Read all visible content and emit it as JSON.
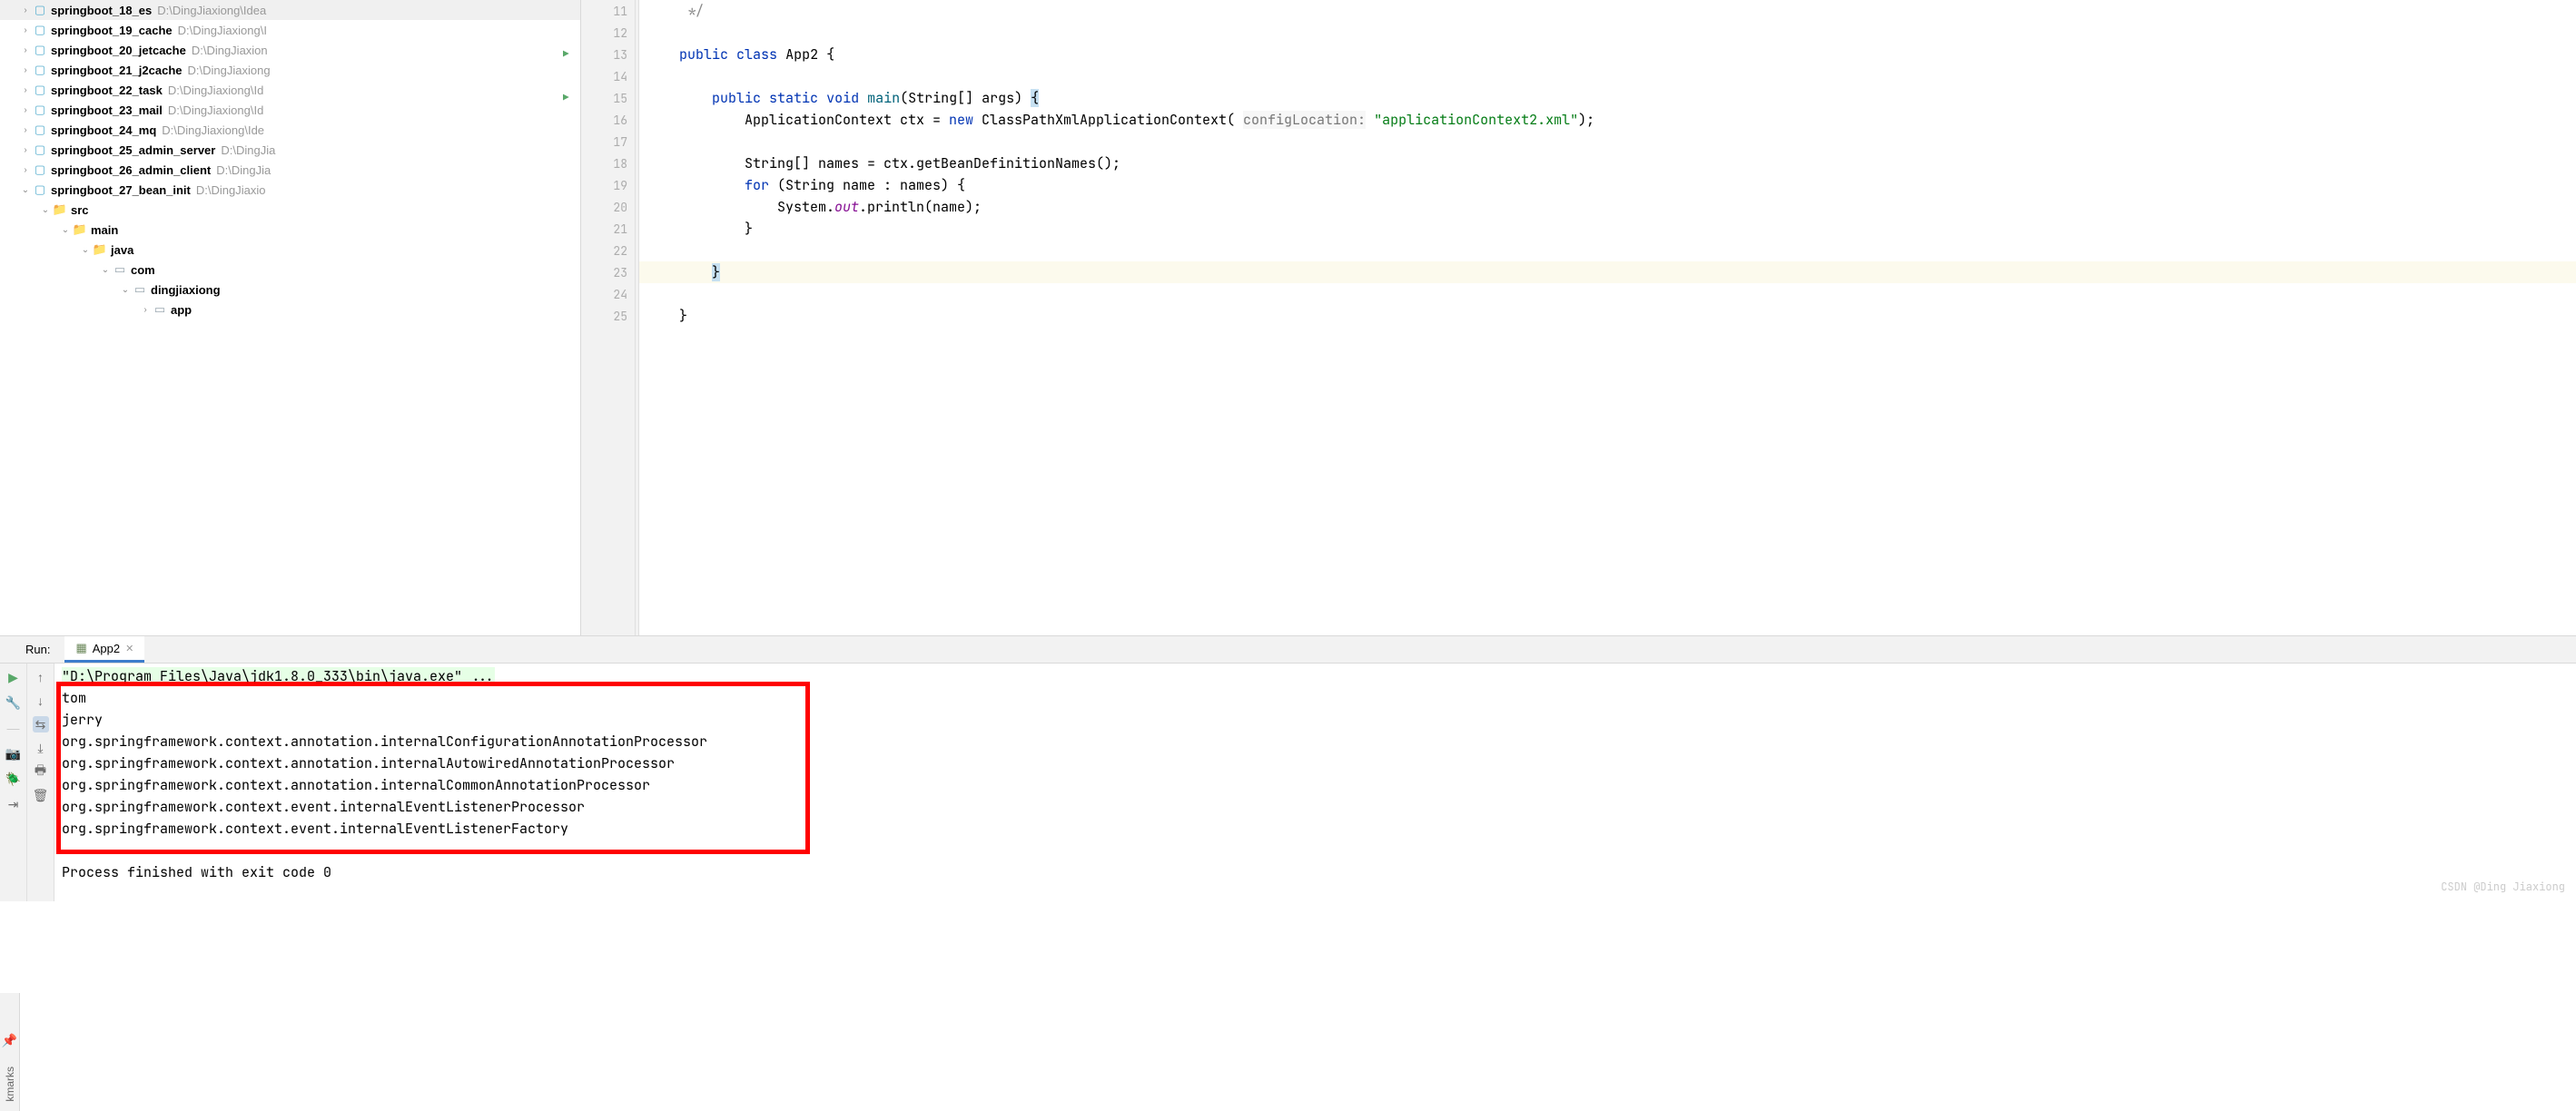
{
  "tree": [
    {
      "indent": 0,
      "chev": "›",
      "icon": "mod",
      "name": "springboot_18_es",
      "path": "D:\\DingJiaxiong\\Idea"
    },
    {
      "indent": 0,
      "chev": "›",
      "icon": "mod",
      "name": "springboot_19_cache",
      "path": "D:\\DingJiaxiong\\I"
    },
    {
      "indent": 0,
      "chev": "›",
      "icon": "mod",
      "name": "springboot_20_jetcache",
      "path": "D:\\DingJiaxion"
    },
    {
      "indent": 0,
      "chev": "›",
      "icon": "mod",
      "name": "springboot_21_j2cache",
      "path": "D:\\DingJiaxiong"
    },
    {
      "indent": 0,
      "chev": "›",
      "icon": "mod",
      "name": "springboot_22_task",
      "path": "D:\\DingJiaxiong\\Id"
    },
    {
      "indent": 0,
      "chev": "›",
      "icon": "mod",
      "name": "springboot_23_mail",
      "path": "D:\\DingJiaxiong\\Id"
    },
    {
      "indent": 0,
      "chev": "›",
      "icon": "mod",
      "name": "springboot_24_mq",
      "path": "D:\\DingJiaxiong\\Ide"
    },
    {
      "indent": 0,
      "chev": "›",
      "icon": "mod",
      "name": "springboot_25_admin_server",
      "path": "D:\\DingJia"
    },
    {
      "indent": 0,
      "chev": "›",
      "icon": "mod",
      "name": "springboot_26_admin_client",
      "path": "D:\\DingJia"
    },
    {
      "indent": 0,
      "chev": "⌄",
      "icon": "mod",
      "name": "springboot_27_bean_init",
      "path": "D:\\DingJiaxio"
    },
    {
      "indent": 1,
      "chev": "⌄",
      "icon": "src",
      "name": "src",
      "path": ""
    },
    {
      "indent": 2,
      "chev": "⌄",
      "icon": "src",
      "name": "main",
      "path": ""
    },
    {
      "indent": 3,
      "chev": "⌄",
      "icon": "java",
      "name": "java",
      "path": ""
    },
    {
      "indent": 4,
      "chev": "⌄",
      "icon": "pkg",
      "name": "com",
      "path": ""
    },
    {
      "indent": 5,
      "chev": "⌄",
      "icon": "pkg",
      "name": "dingjiaxiong",
      "path": ""
    },
    {
      "indent": 6,
      "chev": "›",
      "icon": "pkg",
      "name": "app",
      "path": ""
    }
  ],
  "gutter": [
    "11",
    "12",
    "13",
    "14",
    "15",
    "16",
    "17",
    "18",
    "19",
    "20",
    "21",
    "22",
    "23",
    "24",
    "25"
  ],
  "runIcons": {
    "13": true,
    "15": true
  },
  "code": {
    "l11": "     */",
    "l13_kw1": "public",
    "l13_kw2": "class",
    "l13_name": "App2 {",
    "l15_kw1": "public",
    "l15_kw2": "static",
    "l15_kw3": "void",
    "l15_mn": "main",
    "l15_rest": "(String[] args) ",
    "l15_brace": "{",
    "l16_a": "            ApplicationContext ctx = ",
    "l16_kw": "new",
    "l16_b": " ClassPathXmlApplicationContext( ",
    "l16_p": "configLocation:",
    "l16_c": " ",
    "l16_s": "\"applicationContext2.xml\"",
    "l16_d": ");",
    "l18": "            String[] names = ctx.getBeanDefinitionNames();",
    "l19_a": "            ",
    "l19_kw": "for",
    "l19_b": " (String name : names) {",
    "l20_a": "                System.",
    "l20_f": "out",
    "l20_b": ".println(name);",
    "l21": "            }",
    "l23": "        ",
    "l23_b": "}",
    "l24": "",
    "l25": "    }"
  },
  "run": {
    "label": "Run:",
    "tab": "App2",
    "cmd": "\"D:\\Program Files\\Java\\jdk1.8.0_333\\bin\\java.exe\" ...",
    "out": [
      "tom",
      "jerry",
      "org.springframework.context.annotation.internalConfigurationAnnotationProcessor",
      "org.springframework.context.annotation.internalAutowiredAnnotationProcessor",
      "org.springframework.context.annotation.internalCommonAnnotationProcessor",
      "org.springframework.context.event.internalEventListenerProcessor",
      "org.springframework.context.event.internalEventListenerFactory"
    ],
    "exit": "Process finished with exit code 0"
  },
  "leftStrip": "kmarks",
  "watermark": "CSDN @Ding Jiaxiong"
}
